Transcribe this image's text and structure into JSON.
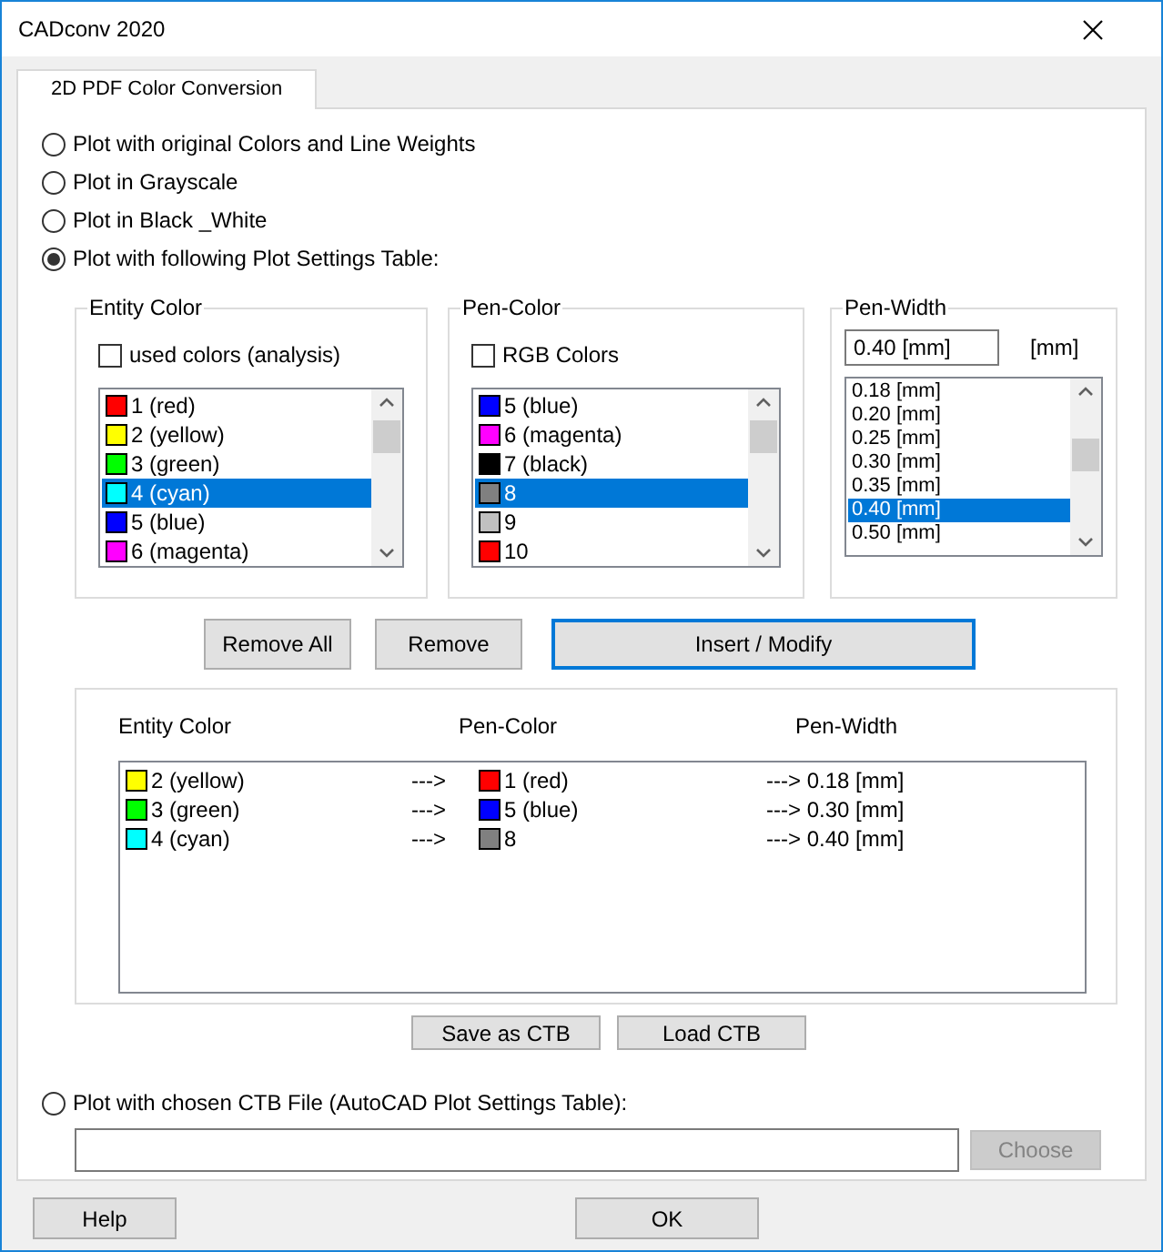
{
  "window": {
    "title": "CADconv 2020"
  },
  "tabs": [
    {
      "label": "2D PDF Color Conversion",
      "selected": true
    }
  ],
  "modes": [
    {
      "label": "Plot with original Colors and Line Weights",
      "selected": false
    },
    {
      "label": "Plot in Grayscale",
      "selected": false
    },
    {
      "label": "Plot in Black _White",
      "selected": false
    },
    {
      "label": "Plot with following Plot Settings Table:",
      "selected": true
    }
  ],
  "entity_color": {
    "title": "Entity Color",
    "checkbox": {
      "label": "used colors (analysis)",
      "checked": false
    },
    "items": [
      {
        "label": "1 (red)",
        "color": "#ff0000",
        "selected": false
      },
      {
        "label": "2 (yellow)",
        "color": "#ffff00",
        "selected": false
      },
      {
        "label": "3 (green)",
        "color": "#00ff00",
        "selected": false
      },
      {
        "label": "4 (cyan)",
        "color": "#00ffff",
        "selected": true
      },
      {
        "label": "5 (blue)",
        "color": "#0000ff",
        "selected": false
      },
      {
        "label": "6 (magenta)",
        "color": "#ff00ff",
        "selected": false
      }
    ]
  },
  "pen_color": {
    "title": "Pen-Color",
    "checkbox": {
      "label": "RGB Colors",
      "checked": false
    },
    "items": [
      {
        "label": "5 (blue)",
        "color": "#0000ff",
        "selected": false
      },
      {
        "label": "6 (magenta)",
        "color": "#ff00ff",
        "selected": false
      },
      {
        "label": "7 (black)",
        "color": "#000000",
        "selected": false
      },
      {
        "label": "8",
        "color": "#808080",
        "selected": true
      },
      {
        "label": "9",
        "color": "#c0c0c0",
        "selected": false
      },
      {
        "label": "10",
        "color": "#ff0000",
        "selected": false
      }
    ]
  },
  "pen_width": {
    "title": "Pen-Width",
    "value": "0.40 [mm]",
    "unit": "[mm]",
    "items": [
      {
        "label": "0.18 [mm]",
        "selected": false
      },
      {
        "label": "0.20 [mm]",
        "selected": false
      },
      {
        "label": "0.25 [mm]",
        "selected": false
      },
      {
        "label": "0.30 [mm]",
        "selected": false
      },
      {
        "label": "0.35 [mm]",
        "selected": false
      },
      {
        "label": "0.40 [mm]",
        "selected": true
      },
      {
        "label": "0.50 [mm]",
        "selected": false
      }
    ]
  },
  "buttons": [
    {
      "label": "Remove All",
      "focused": false
    },
    {
      "label": "Remove",
      "focused": false
    },
    {
      "label": "Insert / Modify",
      "focused": true
    }
  ],
  "mapping": {
    "columns": [
      "Entity Color",
      "Pen-Color",
      "Pen-Width"
    ],
    "rows": [
      {
        "entity": {
          "label": "2 (yellow)",
          "color": "#ffff00"
        },
        "arrow": "--->",
        "pen": {
          "label": "1 (red)",
          "color": "#ff0000"
        },
        "width": "---> 0.18 [mm]"
      },
      {
        "entity": {
          "label": "3 (green)",
          "color": "#00ff00"
        },
        "arrow": "--->",
        "pen": {
          "label": "5 (blue)",
          "color": "#0000ff"
        },
        "width": "---> 0.30 [mm]"
      },
      {
        "entity": {
          "label": "4 (cyan)",
          "color": "#00ffff"
        },
        "arrow": "--->",
        "pen": {
          "label": "8",
          "color": "#808080"
        },
        "width": "---> 0.40 [mm]"
      }
    ]
  },
  "file_buttons": [
    "Save as CTB",
    "Load CTB"
  ],
  "ctb_mode": {
    "label": "Plot with chosen CTB File (AutoCAD Plot Settings Table):",
    "selected": false
  },
  "choose_button": {
    "label": "Choose",
    "disabled": true
  },
  "footer_buttons": [
    "Help",
    "OK"
  ]
}
